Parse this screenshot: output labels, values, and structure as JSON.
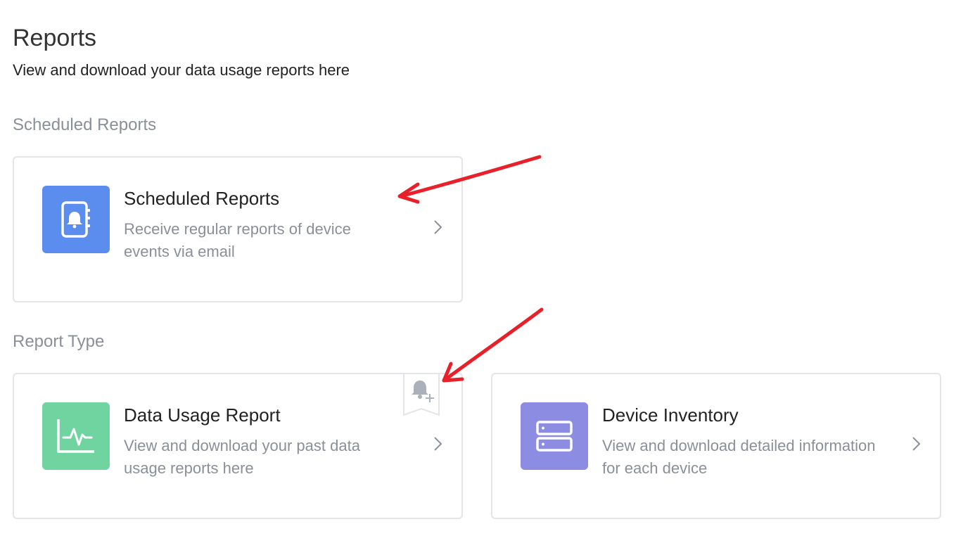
{
  "header": {
    "title": "Reports",
    "subtitle": "View and download your data usage reports here"
  },
  "sections": {
    "scheduled": {
      "label": "Scheduled Reports",
      "card": {
        "title": "Scheduled Reports",
        "description": "Receive regular reports of device events via email",
        "icon": "notebook-bell-icon",
        "icon_color": "#5b8def"
      }
    },
    "report_type": {
      "label": "Report Type",
      "cards": [
        {
          "title": "Data Usage Report",
          "description": "View and download your past data usage reports here",
          "icon": "activity-chart-icon",
          "icon_color": "#6fd4a0",
          "badge_icon": "bell-plus-icon"
        },
        {
          "title": "Device Inventory",
          "description": "View and download detailed information for each device",
          "icon": "server-icon",
          "icon_color": "#8c8ce3"
        }
      ]
    }
  },
  "colors": {
    "annotation_arrow": "#e8202a",
    "card_border": "#e3e5e8",
    "muted_text": "#8a8f98"
  }
}
